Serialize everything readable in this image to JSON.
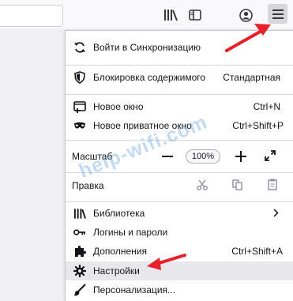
{
  "menu": {
    "sync": "Войти в Синхронизацию",
    "content_blocking": "Блокировка содержимого",
    "content_blocking_value": "Стандартная",
    "new_window": "Новое окно",
    "new_window_shortcut": "Ctrl+N",
    "new_private_window": "Новое приватное окно",
    "new_private_window_shortcut": "Ctrl+Shift+P",
    "zoom_label": "Масштаб",
    "zoom_value": "100%",
    "edit_label": "Правка",
    "library": "Библиотека",
    "logins": "Логины и пароли",
    "addons": "Дополнения",
    "addons_shortcut": "Ctrl+Shift+A",
    "settings": "Настройки",
    "customize": "Персонализация..."
  },
  "watermark": "help-wifi.com",
  "icons": [
    "library-icon",
    "sidebar-icon",
    "account-icon",
    "hamburger-menu-icon",
    "sync-icon",
    "shield-icon",
    "new-window-icon",
    "private-mask-icon",
    "zoom-out-icon",
    "zoom-in-icon",
    "fullscreen-icon",
    "cut-icon",
    "copy-icon",
    "paste-icon",
    "library-books-icon",
    "chevron-right-icon",
    "key-icon",
    "puzzle-icon",
    "gear-icon",
    "brush-icon"
  ],
  "colors": {
    "annotation_arrow": "#e8202a",
    "highlight": "#e8e8ec",
    "watermark": "#60a0dc"
  }
}
